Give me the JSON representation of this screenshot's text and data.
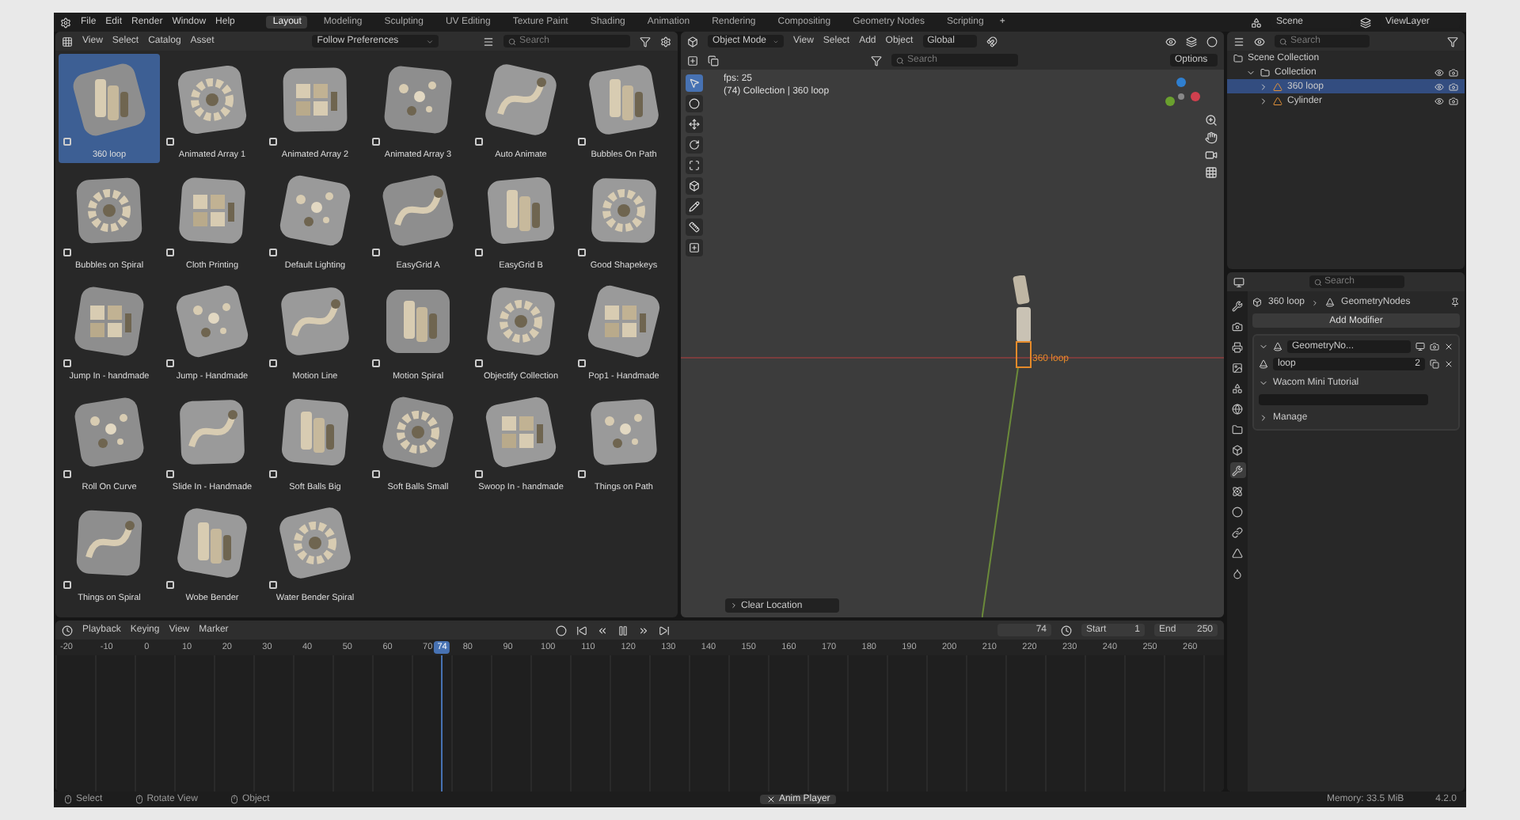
{
  "menu": [
    "File",
    "Edit",
    "Render",
    "Window",
    "Help"
  ],
  "workspaces": [
    {
      "label": "Layout",
      "selected": true
    },
    {
      "label": "Modeling",
      "selected": false
    },
    {
      "label": "Sculpting",
      "selected": false
    },
    {
      "label": "UV Editing",
      "selected": false
    },
    {
      "label": "Texture Paint",
      "selected": false
    },
    {
      "label": "Shading",
      "selected": false
    },
    {
      "label": "Animation",
      "selected": false
    },
    {
      "label": "Rendering",
      "selected": false
    },
    {
      "label": "Compositing",
      "selected": false
    },
    {
      "label": "Geometry Nodes",
      "selected": false
    },
    {
      "label": "Scripting",
      "selected": false
    }
  ],
  "add_workspace": "+",
  "scene": "Scene",
  "view_layer": "ViewLayer",
  "asset_browser": {
    "menu": [
      "View",
      "Select",
      "Catalog",
      "Asset"
    ],
    "import_method": "Follow Preferences",
    "search": {
      "placeholder": "Search"
    },
    "assets": [
      {
        "label": "360 loop",
        "selected": true
      },
      {
        "label": "Animated Array 1",
        "selected": false
      },
      {
        "label": "Animated Array 2",
        "selected": false
      },
      {
        "label": "Animated Array 3",
        "selected": false
      },
      {
        "label": "Auto Animate",
        "selected": false
      },
      {
        "label": "Bubbles On Path",
        "selected": false
      },
      {
        "label": "Bubbles on Spiral",
        "selected": false
      },
      {
        "label": "Cloth Printing",
        "selected": false
      },
      {
        "label": "Default  Lighting",
        "selected": false
      },
      {
        "label": "EasyGrid A",
        "selected": false
      },
      {
        "label": "EasyGrid B",
        "selected": false
      },
      {
        "label": "Good Shapekeys",
        "selected": false
      },
      {
        "label": "Jump In - handmade",
        "selected": false
      },
      {
        "label": "Jump - Handmade",
        "selected": false
      },
      {
        "label": "Motion Line",
        "selected": false
      },
      {
        "label": "Motion Spiral",
        "selected": false
      },
      {
        "label": "Objectify Collection",
        "selected": false
      },
      {
        "label": "Pop1 - Handmade",
        "selected": false
      },
      {
        "label": "Roll On Curve",
        "selected": false
      },
      {
        "label": "Slide In - Handmade",
        "selected": false
      },
      {
        "label": "Soft Balls Big",
        "selected": false
      },
      {
        "label": "Soft Balls Small",
        "selected": false
      },
      {
        "label": "Swoop In - handmade",
        "selected": false
      },
      {
        "label": "Things on Path",
        "selected": false
      },
      {
        "label": "Things on Spiral",
        "selected": false
      },
      {
        "label": "Wobe Bender",
        "selected": false
      },
      {
        "label": "Water Bender Spiral",
        "selected": false
      }
    ]
  },
  "viewport": {
    "mode": "Object Mode",
    "menu": [
      "View",
      "Select",
      "Add",
      "Object"
    ],
    "orientation": "Global",
    "search": {
      "placeholder": "Search"
    },
    "options": "Options",
    "fps": "fps: 25",
    "context": "(74) Collection | 360 loop",
    "object_label": "360 loop",
    "last_operation": "Clear Location"
  },
  "outliner": {
    "search": {
      "placeholder": "Search"
    },
    "root": "Scene Collection",
    "tree": [
      {
        "label": "Collection",
        "kind": "collection",
        "expanded": true,
        "selected": false,
        "children": [
          {
            "label": "360 loop",
            "kind": "object",
            "expanded": false,
            "selected": true
          },
          {
            "label": "Cylinder",
            "kind": "object",
            "expanded": false,
            "selected": false
          }
        ]
      }
    ]
  },
  "properties": {
    "search": {
      "placeholder": "Search"
    },
    "object": "360 loop",
    "data_path": "GeometryNodes",
    "add_modifier": "Add Modifier",
    "modifier": {
      "name": "GeometryNo...",
      "expanded": true,
      "node_group": "loop",
      "users": "2"
    },
    "panels": [
      {
        "label": "Wacom Mini Tutorial",
        "expanded": true
      },
      {
        "label": "Manage",
        "expanded": false
      }
    ],
    "tabs": [
      {
        "kind": "tool",
        "selected": false
      },
      {
        "kind": "render",
        "selected": false
      },
      {
        "kind": "output",
        "selected": false
      },
      {
        "kind": "view_layer",
        "selected": false
      },
      {
        "kind": "scene",
        "selected": false
      },
      {
        "kind": "world",
        "selected": false
      },
      {
        "kind": "collection",
        "selected": false
      },
      {
        "kind": "object",
        "selected": false
      },
      {
        "kind": "modifier",
        "selected": true
      },
      {
        "kind": "particles",
        "selected": false
      },
      {
        "kind": "physics",
        "selected": false
      },
      {
        "kind": "constraints",
        "selected": false
      },
      {
        "kind": "data",
        "selected": false
      },
      {
        "kind": "material",
        "selected": false
      }
    ]
  },
  "timeline": {
    "menu": [
      "Playback",
      "Keying",
      "View",
      "Marker"
    ],
    "current_frame": "74",
    "start_label": "Start",
    "start": "1",
    "end_label": "End",
    "end": "250",
    "ruler": [
      "-20",
      "-10",
      "0",
      "10",
      "20",
      "30",
      "40",
      "50",
      "60",
      "70",
      "80",
      "90",
      "100",
      "110",
      "120",
      "130",
      "140",
      "150",
      "160",
      "170",
      "180",
      "190",
      "200",
      "210",
      "220",
      "230",
      "240",
      "250",
      "260"
    ],
    "playhead": {
      "label": "74",
      "level": 0.331
    }
  },
  "status": {
    "items": [
      "Select",
      "Rotate View",
      "Object"
    ],
    "notice": "Anim Player",
    "memory": "Memory: 33.5 MiB",
    "version": "4.2.0"
  }
}
